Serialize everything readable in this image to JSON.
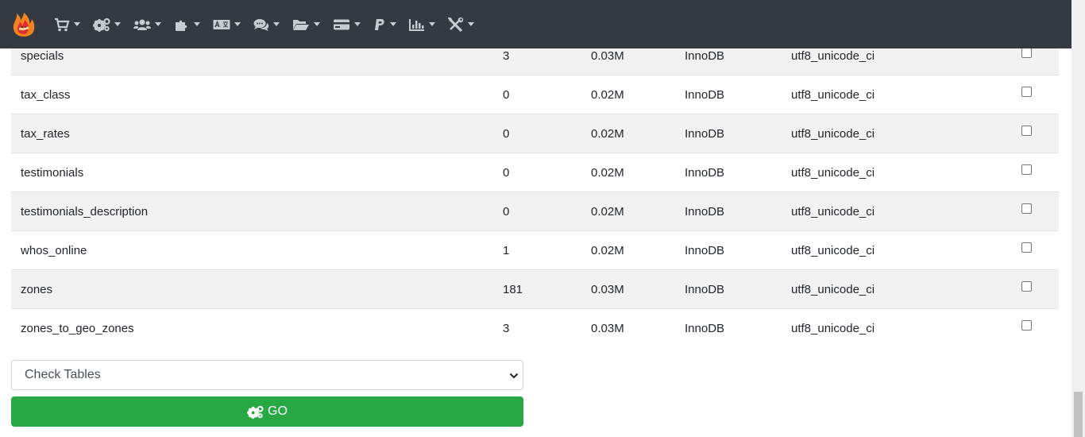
{
  "navbar": {
    "menus": [
      {
        "icon": "cart-icon"
      },
      {
        "icon": "gears-icon"
      },
      {
        "icon": "users-icon"
      },
      {
        "icon": "puzzle-icon"
      },
      {
        "icon": "language-icon"
      },
      {
        "icon": "comments-icon"
      },
      {
        "icon": "folder-open-icon"
      },
      {
        "icon": "credit-card-icon"
      },
      {
        "icon": "paypal-icon"
      },
      {
        "icon": "chart-bar-icon"
      },
      {
        "icon": "tools-icon"
      }
    ]
  },
  "table": {
    "rows": [
      {
        "name": "specials",
        "rows": "3",
        "size": "0.03M",
        "engine": "InnoDB",
        "collation": "utf8_unicode_ci"
      },
      {
        "name": "tax_class",
        "rows": "0",
        "size": "0.02M",
        "engine": "InnoDB",
        "collation": "utf8_unicode_ci"
      },
      {
        "name": "tax_rates",
        "rows": "0",
        "size": "0.02M",
        "engine": "InnoDB",
        "collation": "utf8_unicode_ci"
      },
      {
        "name": "testimonials",
        "rows": "0",
        "size": "0.02M",
        "engine": "InnoDB",
        "collation": "utf8_unicode_ci"
      },
      {
        "name": "testimonials_description",
        "rows": "0",
        "size": "0.02M",
        "engine": "InnoDB",
        "collation": "utf8_unicode_ci"
      },
      {
        "name": "whos_online",
        "rows": "1",
        "size": "0.02M",
        "engine": "InnoDB",
        "collation": "utf8_unicode_ci"
      },
      {
        "name": "zones",
        "rows": "181",
        "size": "0.03M",
        "engine": "InnoDB",
        "collation": "utf8_unicode_ci"
      },
      {
        "name": "zones_to_geo_zones",
        "rows": "3",
        "size": "0.03M",
        "engine": "InnoDB",
        "collation": "utf8_unicode_ci"
      }
    ]
  },
  "action": {
    "selected": "Check Tables",
    "go_label": "GO"
  },
  "colors": {
    "navbar": "#343a40",
    "go_button": "#28a745"
  }
}
